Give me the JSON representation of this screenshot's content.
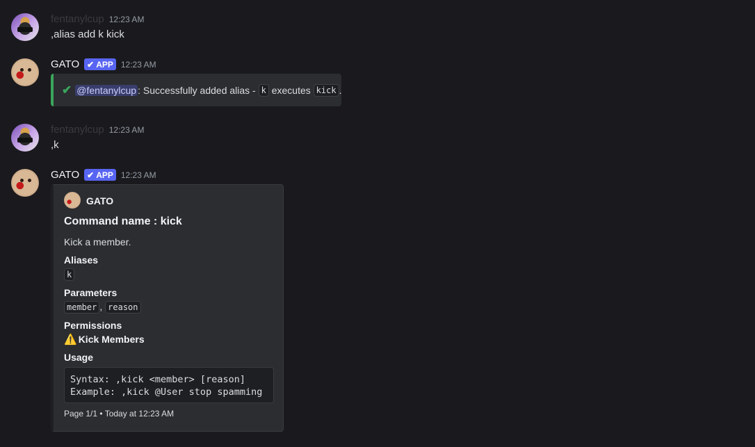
{
  "messages": [
    {
      "username": "fentanylcup",
      "timestamp": "12:23 AM",
      "content": ",alias add k kick"
    },
    {
      "username": "GATO",
      "badge": "APP",
      "timestamp": "12:23 AM",
      "embed": {
        "check_icon": "check-icon",
        "mention": "@fentanylcup",
        "text_before": ": Successfully added alias - ",
        "code1": "k",
        "text_middle": " executes ",
        "code2": "kick",
        "text_after": ".",
        "accent_color": "#3ba55c"
      }
    },
    {
      "username": "fentanylcup",
      "timestamp": "12:23 AM",
      "content": ",k"
    },
    {
      "username": "GATO",
      "badge": "APP",
      "timestamp": "12:23 AM",
      "embed": {
        "author": "GATO",
        "title": "Command name : kick",
        "description": "Kick a member.",
        "fields": [
          {
            "name": "Aliases",
            "values": [
              "k"
            ]
          },
          {
            "name": "Parameters",
            "values": [
              "member",
              "reason"
            ],
            "separator": ","
          },
          {
            "name": "Permissions",
            "icon": "warning-icon",
            "value": "Kick Members"
          },
          {
            "name": "Usage",
            "code": [
              "Syntax: ,kick <member> [reason]",
              "Example: ,kick @User stop spamming"
            ]
          }
        ],
        "footer": "Page 1/1 • Today at 12:23 AM"
      }
    }
  ]
}
